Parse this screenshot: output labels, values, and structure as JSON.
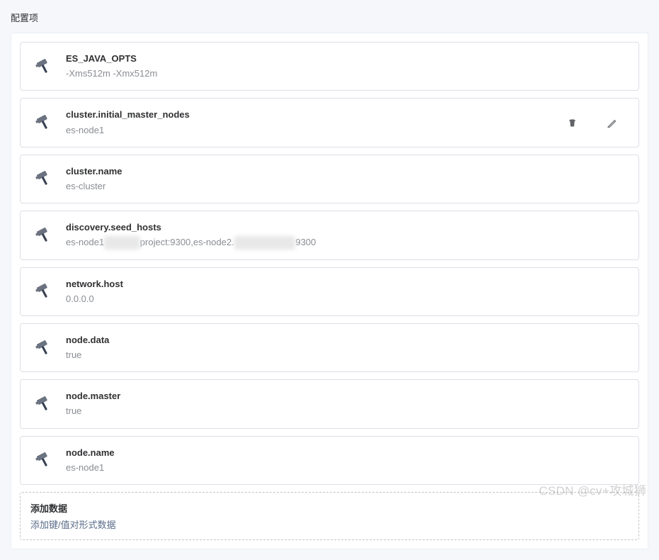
{
  "section_title": "配置项",
  "items": [
    {
      "key": "ES_JAVA_OPTS",
      "value": "-Xms512m -Xmx512m",
      "show_actions": false
    },
    {
      "key": "cluster.initial_master_nodes",
      "value": "es-node1",
      "show_actions": true
    },
    {
      "key": "cluster.name",
      "value": "es-cluster",
      "show_actions": false
    },
    {
      "key": "discovery.seed_hosts",
      "value_prefix": "es-node1",
      "value_mid": "project:9300,es-node2.",
      "value_suffix": "9300",
      "masked": true,
      "show_actions": false
    },
    {
      "key": "network.host",
      "value": "0.0.0.0",
      "show_actions": false
    },
    {
      "key": "node.data",
      "value": "true",
      "show_actions": false
    },
    {
      "key": "node.master",
      "value": "true",
      "show_actions": false
    },
    {
      "key": "node.name",
      "value": "es-node1",
      "show_actions": false
    }
  ],
  "add": {
    "title": "添加数据",
    "subtitle": "添加键/值对形式数据"
  },
  "watermark": "CSDN @cv+攻城狮"
}
